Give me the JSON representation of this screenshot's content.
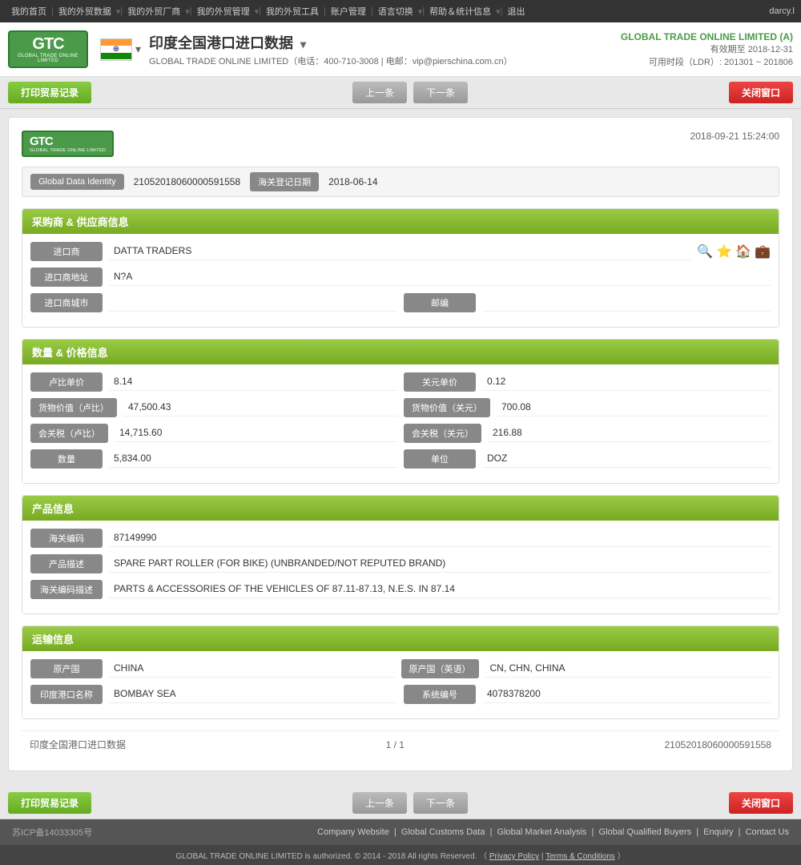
{
  "topnav": {
    "items": [
      "我的首页",
      "我的外贸数据",
      "我的外贸厂商",
      "我的外贸管理",
      "我的外贸工具",
      "账户管理",
      "语言切换",
      "帮助＆统计信息",
      "退出"
    ],
    "user": "darcy.l"
  },
  "header": {
    "page_title": "印度全国港口进口数据",
    "contact": "GLOBAL TRADE ONLINE LIMITED（电话：400-710-3008 | 电邮：vip@pierschina.com.cn）",
    "company": "GLOBAL TRADE ONLINE LIMITED (A)",
    "validity": "有效期至 2018-12-31",
    "ldr": "可用时段（LDR）: 201301 ~ 201806"
  },
  "toolbar": {
    "print_label": "打印贸易记录",
    "prev_label": "上一条",
    "next_label": "下一条",
    "close_label": "关闭窗口"
  },
  "card": {
    "datetime": "2018-09-21 15:24:00",
    "global_data_identity_label": "Global Data Identity",
    "global_data_identity_value": "21052018060000591558",
    "customs_date_label": "海关登记日期",
    "customs_date_value": "2018-06-14"
  },
  "buyer_supplier": {
    "section_title": "采购商 & 供应商信息",
    "importer_label": "进口商",
    "importer_value": "DATTA TRADERS",
    "importer_address_label": "进口商地址",
    "importer_address_value": "N?A",
    "importer_city_label": "进口商城市",
    "importer_city_value": "",
    "zip_label": "邮编",
    "zip_value": ""
  },
  "quantity_price": {
    "section_title": "数量 & 价格信息",
    "rupee_unit_label": "卢比单价",
    "rupee_unit_value": "8.14",
    "usd_unit_label": "关元单价",
    "usd_unit_value": "0.12",
    "goods_value_rupee_label": "货物价值（卢比）",
    "goods_value_rupee_value": "47,500.43",
    "goods_value_usd_label": "货物价值（关元）",
    "goods_value_usd_value": "700.08",
    "total_tax_rupee_label": "会关税（卢比）",
    "total_tax_rupee_value": "14,715.60",
    "total_tax_usd_label": "会关税（关元）",
    "total_tax_usd_value": "216.88",
    "quantity_label": "数量",
    "quantity_value": "5,834.00",
    "unit_label": "单位",
    "unit_value": "DOZ"
  },
  "product_info": {
    "section_title": "产品信息",
    "hs_code_label": "海关编码",
    "hs_code_value": "87149990",
    "product_desc_label": "产品描述",
    "product_desc_value": "SPARE PART ROLLER (FOR BIKE) (UNBRANDED/NOT REPUTED BRAND)",
    "hs_desc_label": "海关编码描述",
    "hs_desc_value": "PARTS & ACCESSORIES OF THE VEHICLES OF 87.11-87.13, N.E.S. IN 87.14"
  },
  "transport_info": {
    "section_title": "运输信息",
    "origin_country_label": "原产国",
    "origin_country_value": "CHINA",
    "origin_country_en_label": "原产国（英语）",
    "origin_country_en_value": "CN, CHN, CHINA",
    "india_port_label": "印度港口名称",
    "india_port_value": "BOMBAY SEA",
    "system_code_label": "系统编号",
    "system_code_value": "4078378200"
  },
  "pagination": {
    "source": "印度全国港口进口数据",
    "page": "1 / 1",
    "record_id": "21052018060000591558"
  },
  "footer": {
    "icp": "苏ICP备14033305号",
    "links": [
      "Company Website",
      "Global Customs Data",
      "Global Market Analysis",
      "Global Qualified Buyers",
      "Enquiry",
      "Contact Us"
    ],
    "copyright": "GLOBAL TRADE ONLINE LIMITED is authorized. © 2014 - 2018 All rights Reserved.  （",
    "privacy": "Privacy Policy",
    "separator": " | ",
    "terms": "Terms & Conditions",
    "copyright_end": "）"
  }
}
